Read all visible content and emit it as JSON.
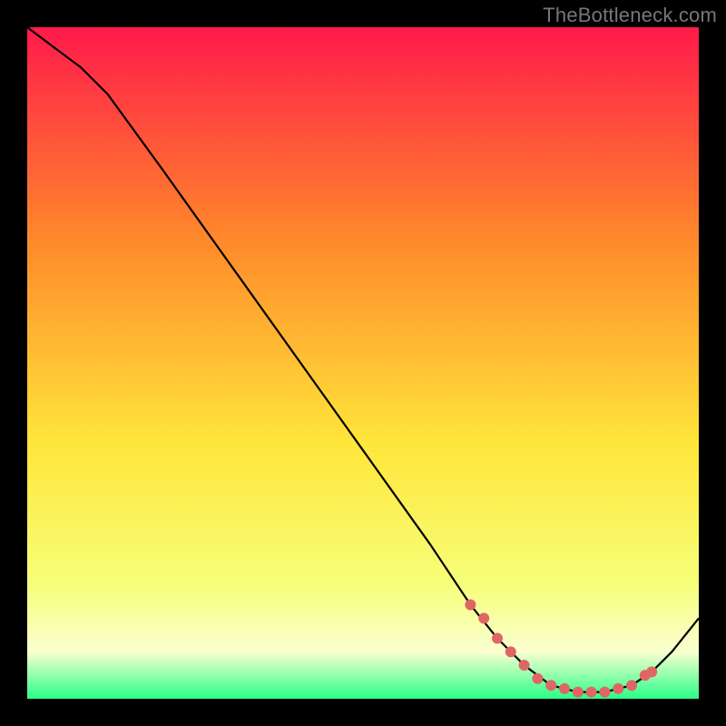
{
  "attribution": "TheBottleneck.com",
  "colors": {
    "gradient_top": "#ff1a4b",
    "gradient_mid_upper": "#ff8a2a",
    "gradient_mid": "#ffe63a",
    "gradient_lower": "#f6ff7a",
    "gradient_pale": "#faffd0",
    "gradient_base": "#2aff88",
    "curve": "#000000",
    "dots": "#e06666",
    "page_bg": "#000000"
  },
  "chart_data": {
    "type": "line",
    "title": "",
    "xlabel": "",
    "ylabel": "",
    "xlim": [
      0,
      100
    ],
    "ylim": [
      0,
      100
    ],
    "series": [
      {
        "name": "bottleneck-curve",
        "x": [
          0,
          4,
          8,
          12,
          20,
          30,
          40,
          50,
          60,
          66,
          70,
          74,
          78,
          82,
          86,
          90,
          93,
          96,
          100
        ],
        "y": [
          100,
          97,
          94,
          90,
          79,
          65,
          51,
          37,
          23,
          14,
          9,
          5,
          2,
          1,
          1,
          2,
          4,
          7,
          12
        ]
      }
    ],
    "valley_markers_x": [
      66,
      68,
      70,
      72,
      74,
      76,
      78,
      80,
      82,
      84,
      86,
      88,
      90,
      92,
      93
    ],
    "valley_markers_y": [
      14,
      12,
      9,
      7,
      5,
      3,
      2,
      1.5,
      1,
      1,
      1,
      1.5,
      2,
      3.5,
      4
    ]
  }
}
